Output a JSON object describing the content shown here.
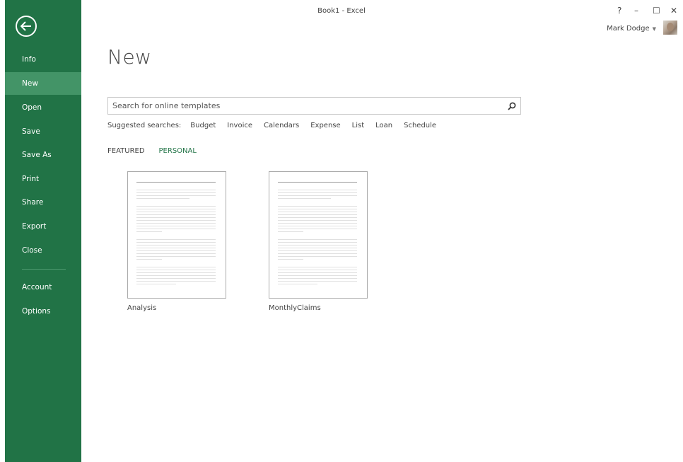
{
  "window": {
    "title": "Book1 - Excel",
    "help": "?",
    "minimize": "–",
    "maximize": "☐",
    "close": "✕"
  },
  "user": {
    "name": "Mark Dodge"
  },
  "sidebar": {
    "items": [
      {
        "label": "Info"
      },
      {
        "label": "New"
      },
      {
        "label": "Open"
      },
      {
        "label": "Save"
      },
      {
        "label": "Save As"
      },
      {
        "label": "Print"
      },
      {
        "label": "Share"
      },
      {
        "label": "Export"
      },
      {
        "label": "Close"
      },
      {
        "label": "Account"
      },
      {
        "label": "Options"
      }
    ],
    "selected": "New"
  },
  "main": {
    "title": "New",
    "search": {
      "placeholder": "Search for online templates",
      "value": ""
    },
    "suggested": {
      "label": "Suggested searches:",
      "items": [
        "Budget",
        "Invoice",
        "Calendars",
        "Expense",
        "List",
        "Loan",
        "Schedule"
      ]
    },
    "tabs": [
      {
        "label": "FEATURED",
        "active": false
      },
      {
        "label": "PERSONAL",
        "active": true
      }
    ],
    "templates": [
      {
        "name": "Analysis"
      },
      {
        "name": "MonthlyClaims"
      }
    ]
  },
  "colors": {
    "accent": "#217346",
    "selected_nav": "#439467"
  }
}
